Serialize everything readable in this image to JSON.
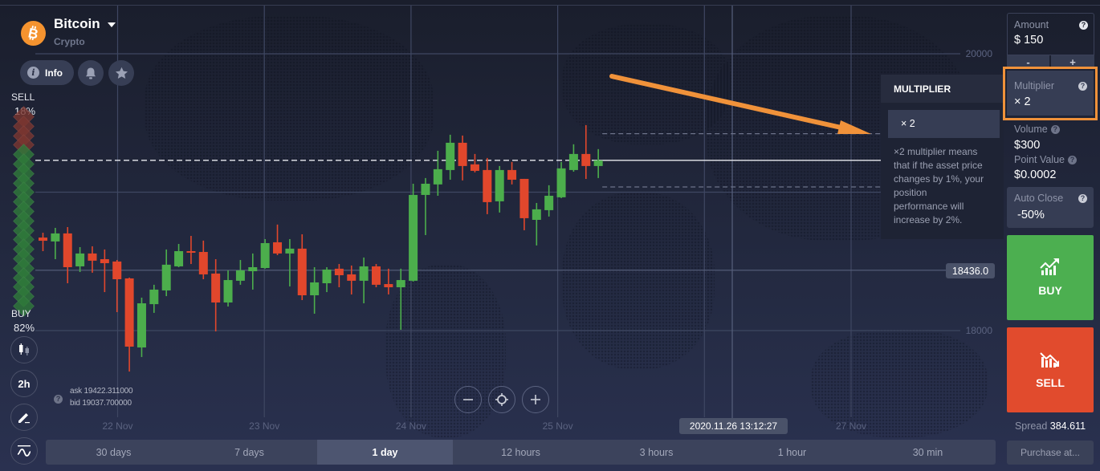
{
  "asset": {
    "name": "Bitcoin",
    "category": "Crypto"
  },
  "asset_actions": {
    "info_label": "Info"
  },
  "sentiment": {
    "sell_label": "SELL",
    "sell_percent": 18,
    "sell_text": "18%",
    "buy_label": "BUY",
    "buy_percent": 82,
    "buy_text": "82%"
  },
  "left_toolbar": {
    "timeframe_label": "2h"
  },
  "quote": {
    "ask_text": "ask 19422.311000",
    "bid_text": "bid 19037.700000",
    "ask": 19422.311,
    "bid": 19037.7
  },
  "chart": {
    "candle_interval": "2h",
    "y_gridlines": [
      20000,
      19000,
      18000
    ],
    "y_labels": [
      {
        "value": 20000,
        "text": "20000"
      },
      {
        "value": 18000,
        "text": "18000"
      }
    ],
    "x_labels": [
      "22 Nov",
      "23 Nov",
      "24 Nov",
      "25 Nov",
      "",
      "27 Nov"
    ],
    "current_price": 19230,
    "crosshair": {
      "price": 18436.0,
      "price_text": "18436.0",
      "time_text": "2020.11.26 13:12:27"
    },
    "candles": [
      [
        18672,
        18707,
        18574,
        18649
      ],
      [
        18644,
        18742,
        18516,
        18702
      ],
      [
        18702,
        18748,
        18342,
        18458
      ],
      [
        18464,
        18603,
        18423,
        18557
      ],
      [
        18557,
        18609,
        18418,
        18505
      ],
      [
        18516,
        18586,
        18278,
        18487
      ],
      [
        18499,
        18510,
        18133,
        18371
      ],
      [
        18377,
        18383,
        17704,
        17884
      ],
      [
        17878,
        18238,
        17809,
        18197
      ],
      [
        18191,
        18331,
        18128,
        18296
      ],
      [
        18290,
        18586,
        18249,
        18476
      ],
      [
        18464,
        18626,
        18458,
        18574
      ],
      [
        18574,
        18684,
        18481,
        18563
      ],
      [
        18568,
        18650,
        18371,
        18406
      ],
      [
        18412,
        18516,
        17994,
        18203
      ],
      [
        18203,
        18435,
        18174,
        18365
      ],
      [
        18360,
        18510,
        18331,
        18435
      ],
      [
        18429,
        18557,
        18296,
        18458
      ],
      [
        18452,
        18661,
        18447,
        18632
      ],
      [
        18638,
        18766,
        18545,
        18557
      ],
      [
        18557,
        18661,
        18319,
        18592
      ],
      [
        18592,
        18696,
        18220,
        18255
      ],
      [
        18255,
        18458,
        18122,
        18348
      ],
      [
        18342,
        18458,
        18278,
        18441
      ],
      [
        18447,
        18481,
        18313,
        18400
      ],
      [
        18406,
        18470,
        18261,
        18360
      ],
      [
        18360,
        18528,
        18197,
        18464
      ],
      [
        18464,
        18481,
        18313,
        18331
      ],
      [
        18336,
        18447,
        18261,
        18313
      ],
      [
        18313,
        18447,
        18006,
        18365
      ],
      [
        18360,
        19061,
        18354,
        18980
      ],
      [
        18980,
        19102,
        18690,
        19061
      ],
      [
        19056,
        19299,
        18974,
        19166
      ],
      [
        19160,
        19415,
        19090,
        19357
      ],
      [
        19357,
        19409,
        19085,
        19189
      ],
      [
        19201,
        19276,
        19143,
        19154
      ],
      [
        19160,
        19247,
        18841,
        18928
      ],
      [
        18934,
        19189,
        18853,
        19160
      ],
      [
        19160,
        19218,
        19056,
        19090
      ],
      [
        19096,
        19096,
        18725,
        18812
      ],
      [
        18800,
        18922,
        18615,
        18876
      ],
      [
        18870,
        19050,
        18824,
        18974
      ],
      [
        18963,
        19218,
        18957,
        19172
      ],
      [
        19160,
        19346,
        19148,
        19276
      ],
      [
        19276,
        19485,
        19096,
        19189
      ],
      [
        19189,
        19311,
        19102,
        19230
      ]
    ]
  },
  "time_ranges": {
    "selected": "1 day",
    "items": [
      "30 days",
      "7 days",
      "1 day",
      "12 hours",
      "3 hours",
      "1 hour",
      "30 min"
    ]
  },
  "multiplier_popup": {
    "title": "MULTIPLIER",
    "option": "× 2",
    "description_lines": [
      "×2 multiplier means",
      "that if the asset price",
      "changes by 1%, your",
      "position",
      "performance will",
      "increase by 2%."
    ]
  },
  "trade_panel": {
    "amount": {
      "label": "Amount",
      "value": "$ 150",
      "minus": "-",
      "plus": "+"
    },
    "multiplier": {
      "label": "Multiplier",
      "value": "× 2"
    },
    "volume": {
      "label": "Volume",
      "value": "$300"
    },
    "point_value": {
      "label": "Point Value",
      "value": "$0.0002"
    },
    "auto_close": {
      "label": "Auto Close",
      "value": "-50%"
    },
    "buy_label": "BUY",
    "sell_label": "SELL",
    "spread_label": "Spread",
    "spread_value": "384.611",
    "purchase_at_label": "Purchase at..."
  },
  "colors": {
    "up": "#4cae4c",
    "down": "#e1472c",
    "accent_orange": "#f0923a",
    "bitcoin": "#f5932f",
    "buy": "#4caf50",
    "sell": "#e14b2d",
    "sentiment_sell": "#7b3630",
    "sentiment_buy": "#2f7a3a"
  }
}
